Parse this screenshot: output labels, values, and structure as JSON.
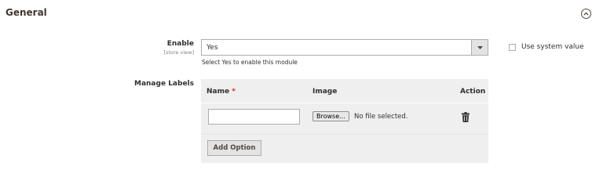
{
  "section": {
    "title": "General",
    "collapse_icon": "chevron-up-circle-icon"
  },
  "enable_field": {
    "label": "Enable",
    "scope": "[store view]",
    "selected_value": "Yes",
    "note": "Select Yes to enable this module",
    "use_system_value_label": "Use system value",
    "use_system_value_checked": false
  },
  "labels_field": {
    "label": "Manage Labels",
    "columns": [
      "Name",
      "Image",
      "Action"
    ],
    "required_marker": "*",
    "rows": [
      {
        "name": "",
        "browse_label": "Browse...",
        "file_status": "No file selected.",
        "delete_icon": "trash-icon"
      }
    ],
    "add_option_label": "Add Option"
  }
}
